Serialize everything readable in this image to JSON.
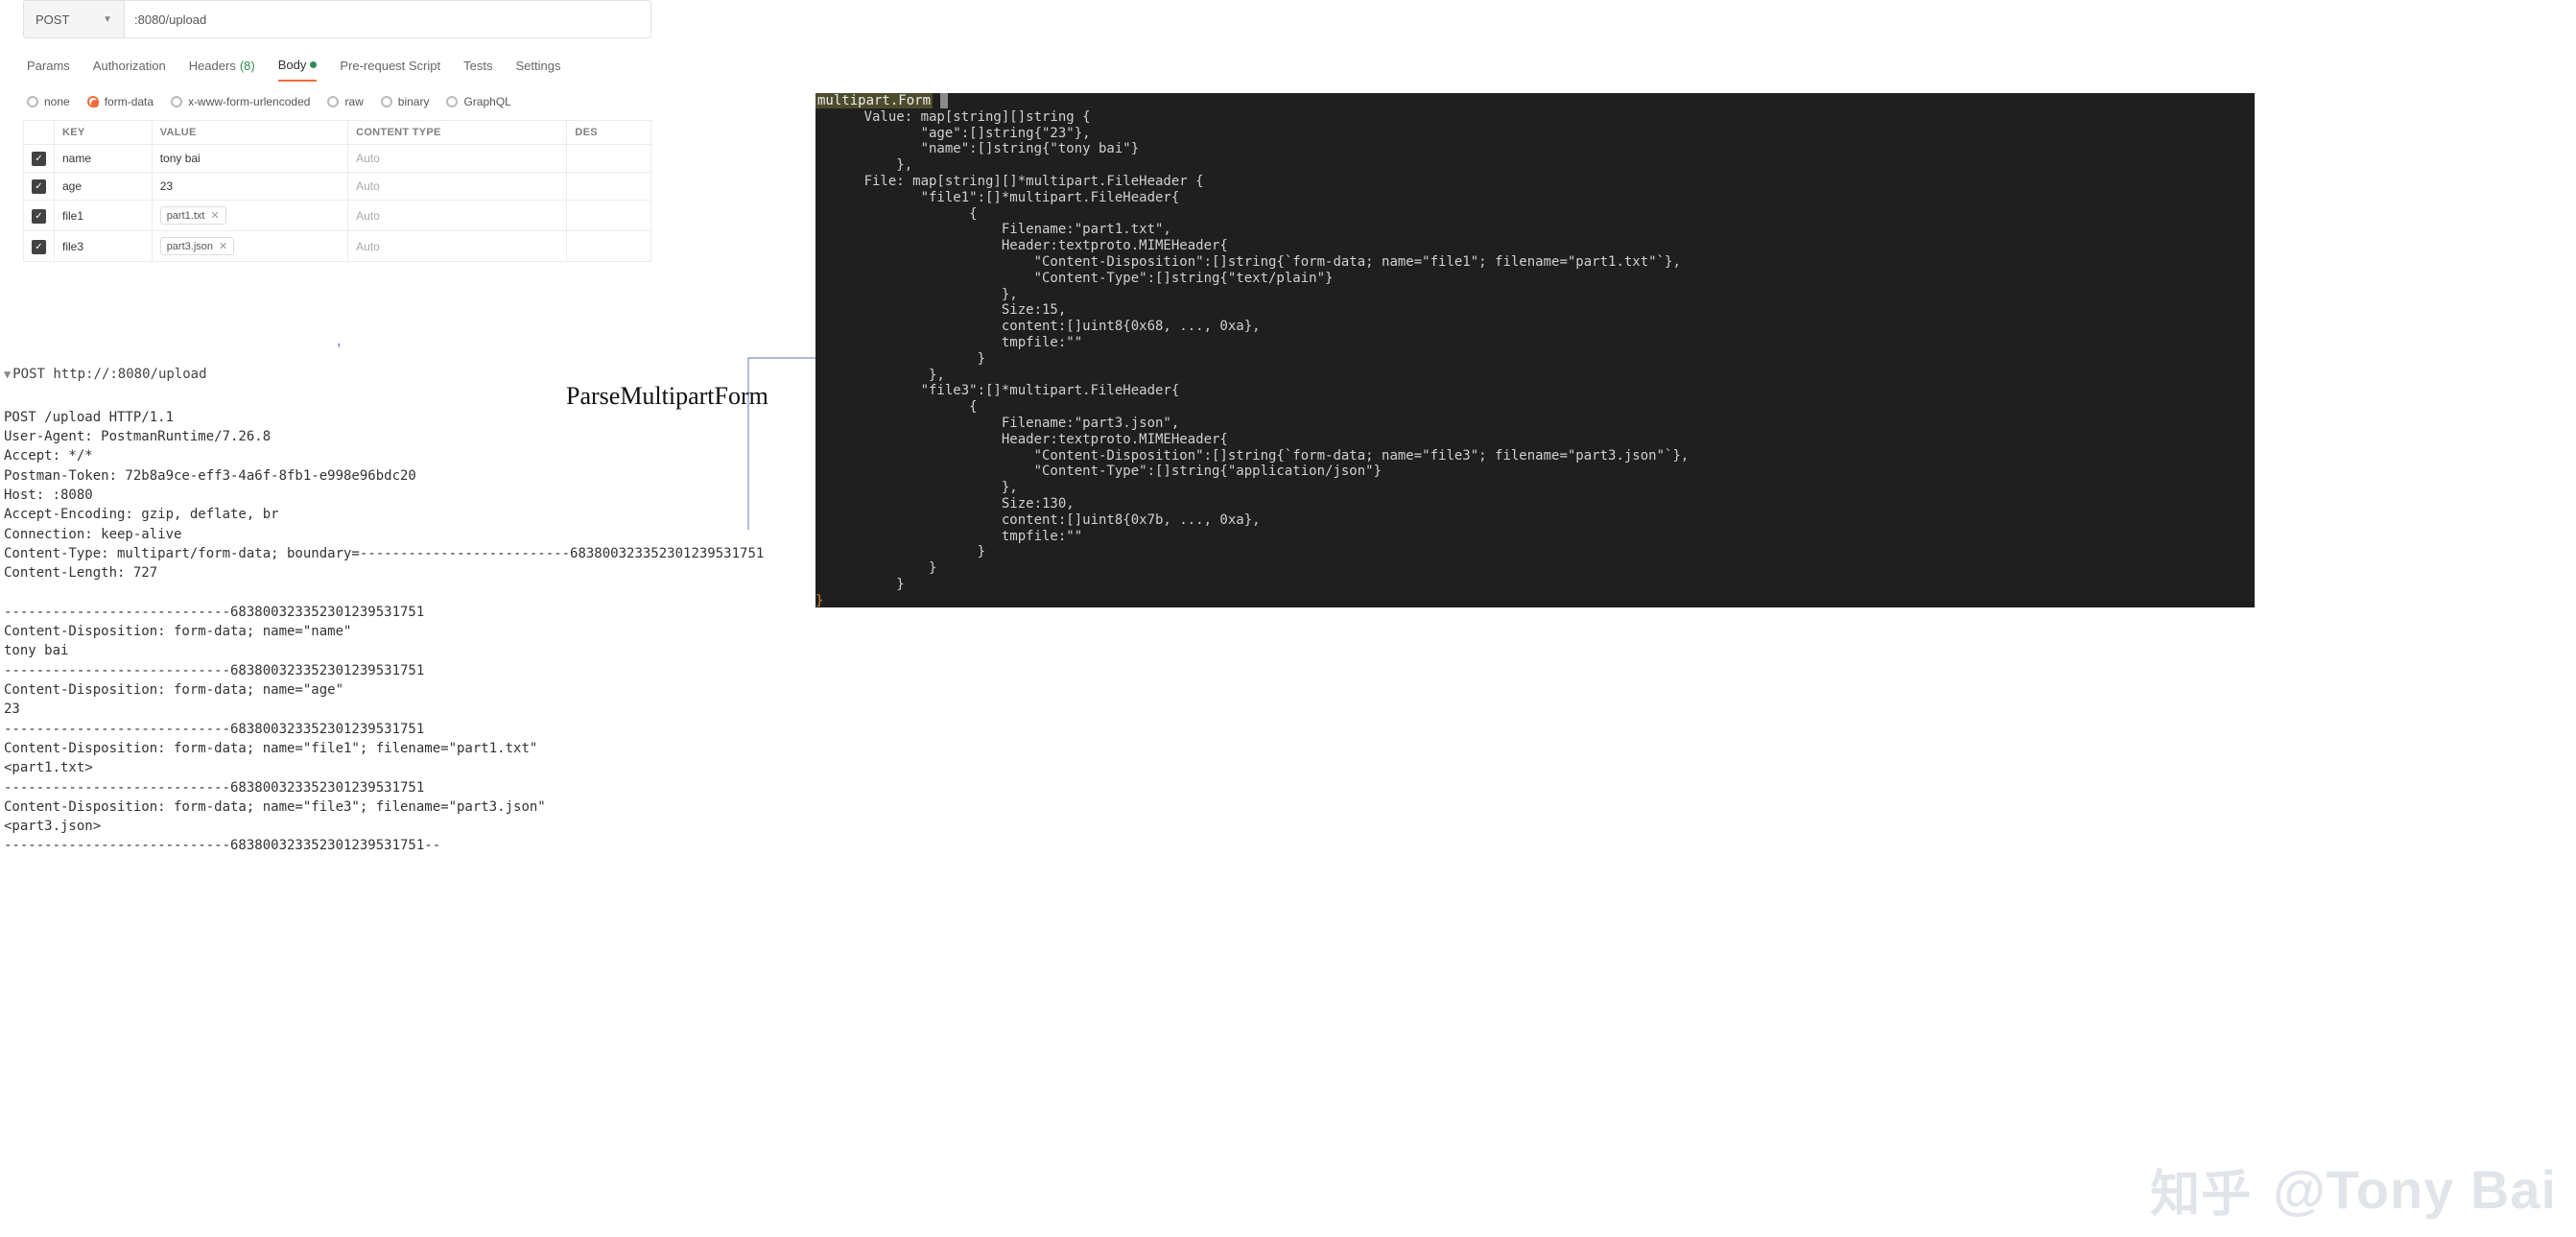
{
  "postman": {
    "method": "POST",
    "url": ":8080/upload",
    "tabs": {
      "params": "Params",
      "authorization": "Authorization",
      "headers": "Headers",
      "headers_count": "(8)",
      "body": "Body",
      "prerequest": "Pre-request Script",
      "tests": "Tests",
      "settings": "Settings"
    },
    "body_types": {
      "none": "none",
      "form_data": "form-data",
      "xwww": "x-www-form-urlencoded",
      "raw": "raw",
      "binary": "binary",
      "graphql": "GraphQL"
    },
    "columns": {
      "key": "KEY",
      "value": "VALUE",
      "content_type": "CONTENT TYPE",
      "desc": "DES"
    },
    "rows": [
      {
        "key": "name",
        "value": "tony bai",
        "content_type": "Auto",
        "is_file": false
      },
      {
        "key": "age",
        "value": "23",
        "content_type": "Auto",
        "is_file": false
      },
      {
        "key": "file1",
        "value": "part1.txt",
        "content_type": "Auto",
        "is_file": true
      },
      {
        "key": "file3",
        "value": "part3.json",
        "content_type": "Auto",
        "is_file": true
      }
    ]
  },
  "raw_request": {
    "title": "POST http://:8080/upload",
    "body": "POST /upload HTTP/1.1\nUser-Agent: PostmanRuntime/7.26.8\nAccept: */*\nPostman-Token: 72b8a9ce-eff3-4a6f-8fb1-e998e96bdc20\nHost: :8080\nAccept-Encoding: gzip, deflate, br\nConnection: keep-alive\nContent-Type: multipart/form-data; boundary=--------------------------683800323352301239531751\nContent-Length: 727\n\n----------------------------683800323352301239531751\nContent-Disposition: form-data; name=\"name\"\ntony bai\n----------------------------683800323352301239531751\nContent-Disposition: form-data; name=\"age\"\n23\n----------------------------683800323352301239531751\nContent-Disposition: form-data; name=\"file1\"; filename=\"part1.txt\"\n<part1.txt>\n----------------------------683800323352301239531751\nContent-Disposition: form-data; name=\"file3\"; filename=\"part3.json\"\n<part3.json>\n----------------------------683800323352301239531751--"
  },
  "parse_label": "ParseMultipartForm",
  "terminal": {
    "header": "multipart.Form",
    "content": "      Value: map[string][]string {\n             \"age\":[]string{\"23\"},\n             \"name\":[]string{\"tony bai\"}\n          },\n      File: map[string][]*multipart.FileHeader {\n             \"file1\":[]*multipart.FileHeader{\n                   {\n                       Filename:\"part1.txt\",\n                       Header:textproto.MIMEHeader{\n                           \"Content-Disposition\":[]string{`form-data; name=\"file1\"; filename=\"part1.txt\"`},\n                           \"Content-Type\":[]string{\"text/plain\"}\n                       },\n                       Size:15,\n                       content:[]uint8{0x68, ..., 0xa},\n                       tmpfile:\"\"\n                    }\n              },\n             \"file3\":[]*multipart.FileHeader{\n                   {\n                       Filename:\"part3.json\",\n                       Header:textproto.MIMEHeader{\n                           \"Content-Disposition\":[]string{`form-data; name=\"file3\"; filename=\"part3.json\"`},\n                           \"Content-Type\":[]string{\"application/json\"}\n                       },\n                       Size:130,\n                       content:[]uint8{0x7b, ..., 0xa},\n                       tmpfile:\"\"\n                    }\n              }\n          }"
  },
  "watermark": {
    "zhihu": "知乎",
    "author": "@Tony Bai"
  }
}
